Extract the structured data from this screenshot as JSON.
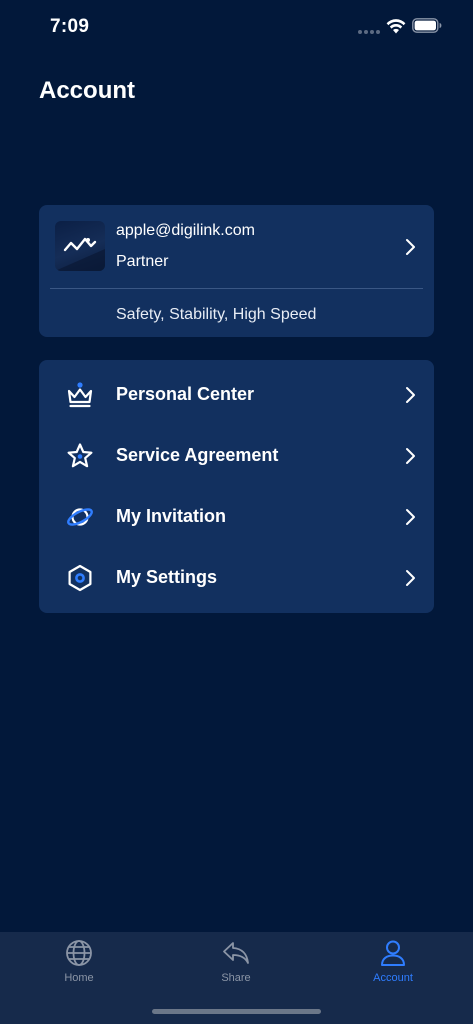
{
  "status_bar": {
    "time": "7:09",
    "icons": [
      "cellular-dots-icon",
      "wifi-icon",
      "battery-icon"
    ]
  },
  "page": {
    "title": "Account"
  },
  "profile": {
    "email": "apple@digilink.com",
    "role": "Partner",
    "slogan": "Safety, Stability, High Speed",
    "avatar_icon": "logo-icon"
  },
  "menu": {
    "items": [
      {
        "label": "Personal Center",
        "icon": "crown-icon"
      },
      {
        "label": "Service Agreement",
        "icon": "star-icon"
      },
      {
        "label": "My Invitation",
        "icon": "planet-icon"
      },
      {
        "label": "My Settings",
        "icon": "hexagon-settings-icon"
      }
    ]
  },
  "tabs": [
    {
      "label": "Home",
      "icon": "globe-icon",
      "active": false
    },
    {
      "label": "Share",
      "icon": "share-arrow-icon",
      "active": false
    },
    {
      "label": "Account",
      "icon": "person-icon",
      "active": true
    }
  ],
  "colors": {
    "background": "#02183a",
    "card": "#12305f",
    "accent": "#2f7dff",
    "tab_bar": "#162a4b",
    "inactive": "#8b95a6"
  }
}
